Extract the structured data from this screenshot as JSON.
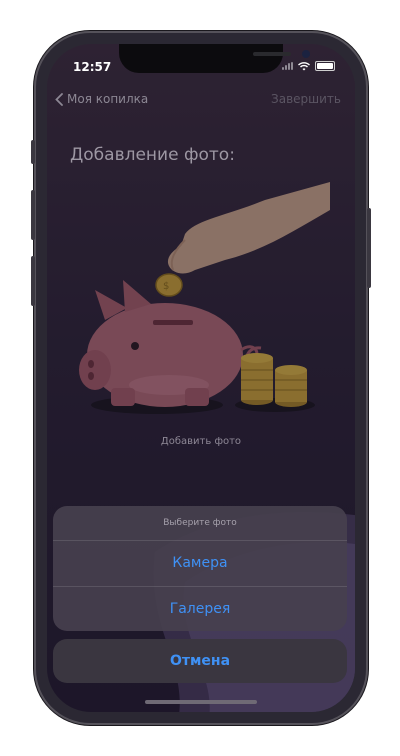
{
  "status_bar": {
    "time": "12:57"
  },
  "nav": {
    "back_label": "Моя копилка",
    "finish_label": "Завершить"
  },
  "content": {
    "heading": "Добавление фото:",
    "add_photo_caption": "Добавить фото"
  },
  "action_sheet": {
    "title": "Выберите фото",
    "options": [
      "Камера",
      "Галерея"
    ],
    "cancel_label": "Отмена"
  },
  "colors": {
    "accent": "#3f91f5",
    "background": "#2c2238",
    "sheet": "#46404e"
  },
  "icons": [
    "chevron-left-icon",
    "signal-icon",
    "wifi-icon",
    "battery-icon",
    "piggy-bank-illustration"
  ]
}
